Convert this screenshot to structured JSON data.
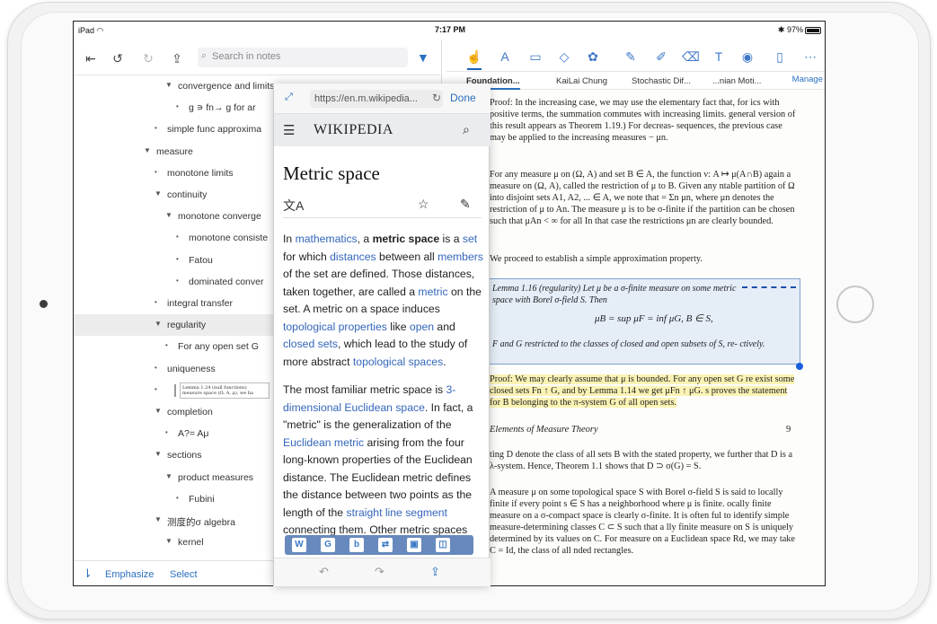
{
  "status": {
    "device": "iPad",
    "time": "7:17 PM",
    "battery": "97%"
  },
  "left_toolbar": {
    "search_placeholder": "Search in notes"
  },
  "outline": [
    {
      "text": "convergence and limits",
      "marker": "▼",
      "indent": 1
    },
    {
      "text": "g ∍ fn→ g for ar",
      "marker": "•",
      "indent": 2
    },
    {
      "text": "simple func approxima",
      "marker": "•",
      "indent": 0
    },
    {
      "text": "measure",
      "marker": "▼",
      "indent": -1
    },
    {
      "text": "monotone limits",
      "marker": "•",
      "indent": 0
    },
    {
      "text": "continuity",
      "marker": "▼",
      "indent": 0
    },
    {
      "text": "monotone converge",
      "marker": "▼",
      "indent": 1
    },
    {
      "text": "monotone consiste",
      "marker": "•",
      "indent": 2
    },
    {
      "text": "Fatou",
      "marker": "•",
      "indent": 2
    },
    {
      "text": "dominated conver",
      "marker": "•",
      "indent": 2
    },
    {
      "text": "integral transfer",
      "marker": "•",
      "indent": 0
    },
    {
      "text": "regularity",
      "marker": "▼",
      "indent": 0,
      "selected": true
    },
    {
      "text": "For any open set G",
      "marker": "•",
      "indent": 1
    },
    {
      "text": "uniqueness",
      "marker": "•",
      "indent": 0
    },
    {
      "text": "Lemma 1.24 (null functions) measure space (Ω, A, μ), we ha",
      "marker": "•",
      "indent": 0,
      "thumb": true
    },
    {
      "text": "completion",
      "marker": "▼",
      "indent": 0
    },
    {
      "text": "A?= Aμ",
      "marker": "•",
      "indent": 1
    },
    {
      "text": "sections",
      "marker": "▼",
      "indent": 0
    },
    {
      "text": "product measures",
      "marker": "▼",
      "indent": 1
    },
    {
      "text": "Fubini",
      "marker": "•",
      "indent": 2
    },
    {
      "text": "测度的σ algebra",
      "marker": "▼",
      "indent": 0
    },
    {
      "text": "kernel",
      "marker": "▼",
      "indent": 1
    }
  ],
  "left_bottom": {
    "emphasize": "Emphasize",
    "select": "Select"
  },
  "pdf_tabs": [
    "Foundation...",
    "KaiLai Chung",
    "Stochastic Dif...",
    "...nian Moti..."
  ],
  "pdf_manage": "Manage",
  "pdf_lines": {
    "proof1": "Proof: In the increasing case, we may use the elementary fact that, for ics with positive terms, the summation commutes with increasing limits. general version of this result appears as Theorem 1.19.) For decreas- sequences, the previous case may be applied to the increasing measures − μn.",
    "para2": "For any measure μ on (Ω, A) and set B ∈ A, the function ν: A ↦ μ(A∩B) again a measure on (Ω, A), called the restriction of μ to B. Given any ntable partition of Ω into disjoint sets A1, A2, ... ∈ A, we note that = Σn μn, where μn denotes the restriction of μ to An. The measure μ is to be σ-finite if the partition can be chosen such that μAn < ∞ for all In that case the restrictions μn are clearly bounded.",
    "para3": "We proceed to establish a simple approximation property.",
    "lemma_head": "Lemma 1.16 (regularity) Let μ be a σ-finite measure on some metric space with Borel σ-field S. Then",
    "lemma_math": "μB = sup μF = inf μG,    B ∈ S,",
    "lemma_tail": "F and G restricted to the classes of closed and open subsets of S, re- ctively.",
    "proof2": "Proof: We may clearly assume that μ is bounded. For any open set G re exist some closed sets Fn ↑ G, and by Lemma 1.14 we get μFn ↑ μG. s proves the statement for B belonging to the π-system G of all open sets.",
    "page_title": "Elements of Measure Theory",
    "page_no": "9",
    "para4": "ting D denote the class of all sets B with the stated property, we further that D is a λ-system. Hence, Theorem 1.1 shows that D ⊃ σ(G) = S.",
    "para5": "A measure μ on some topological space S with Borel σ-field S is said to locally finite if every point s ∈ S has a neighborhood where μ is finite. ocally finite measure on a σ-compact space is clearly σ-finite. It is often ful to identify simple measure-determining classes C ⊂ S such that a lly finite measure on S is uniquely determined by its values on C. For measure on a Euclidean space Rd, we may take C = Id, the class of all nded rectangles."
  },
  "wiki": {
    "url": "https://en.m.wikipedia...",
    "done": "Done",
    "logo": "WIKIPEDIA",
    "title": "Metric space",
    "p1": [
      {
        "t": "In "
      },
      {
        "t": "mathematics",
        "link": true
      },
      {
        "t": ", a "
      },
      {
        "t": "metric space",
        "bold": true
      },
      {
        "t": " is a "
      },
      {
        "t": "set",
        "link": true
      },
      {
        "t": " for which "
      },
      {
        "t": "distances",
        "link": true
      },
      {
        "t": " between all "
      },
      {
        "t": "members",
        "link": true
      },
      {
        "t": " of the set are defined. Those distances, taken together, are called a "
      },
      {
        "t": "metric",
        "link": true
      },
      {
        "t": " on the set. A metric on a space induces "
      },
      {
        "t": "topological properties",
        "link": true
      },
      {
        "t": " like "
      },
      {
        "t": "open",
        "link": true
      },
      {
        "t": " and "
      },
      {
        "t": "closed sets",
        "link": true
      },
      {
        "t": ", which lead to the study of more abstract "
      },
      {
        "t": "topological spaces",
        "link": true
      },
      {
        "t": "."
      }
    ],
    "p2": [
      {
        "t": "The most familiar metric space is "
      },
      {
        "t": "3-dimensional Euclidean space",
        "link": true
      },
      {
        "t": ". In fact, a \"metric\" is the generalization of the "
      },
      {
        "t": "Euclidean metric",
        "link": true
      },
      {
        "t": " arising from the four long-known properties of the Euclidean distance. The Euclidean metric defines the distance between two points as the length of the "
      },
      {
        "t": "straight line segment",
        "link": true
      },
      {
        "t": " connecting them. Other metric spaces"
      }
    ]
  },
  "colors": {
    "accent": "#2b6fbf",
    "highlight": "#fbf3b4",
    "selection": "#e5edf7"
  }
}
